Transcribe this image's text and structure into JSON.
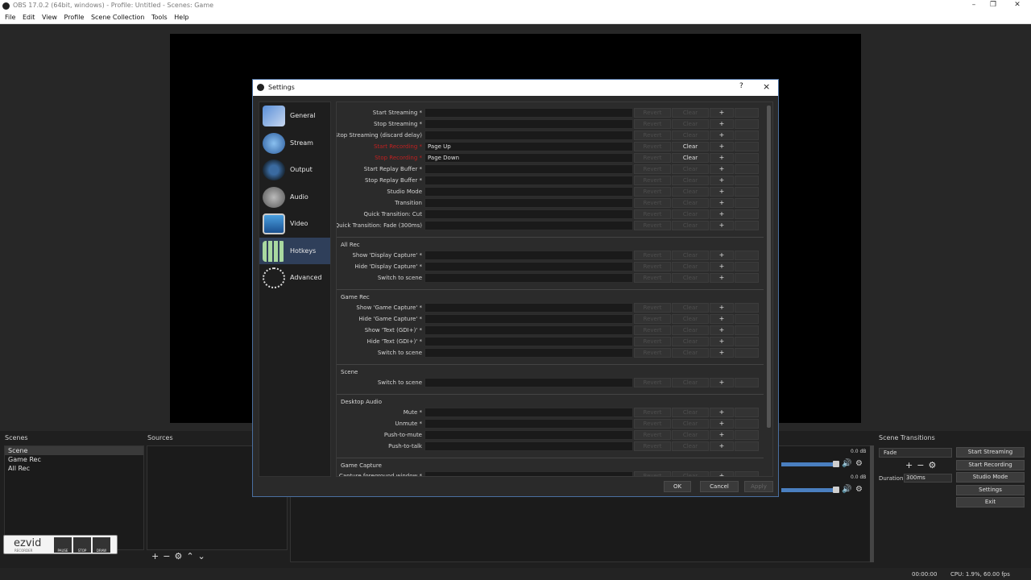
{
  "app": {
    "title": "OBS 17.0.2 (64bit, windows) - Profile: Untitled - Scenes: Game",
    "menu": [
      "File",
      "Edit",
      "View",
      "Profile",
      "Scene Collection",
      "Tools",
      "Help"
    ]
  },
  "docks": {
    "scenes_header": "Scenes",
    "sources_header": "Sources",
    "transitions_header": "Scene Transitions",
    "scenes": [
      "Scene",
      "Game Rec",
      "All Rec"
    ],
    "selected_scene": "Scene",
    "transition": "Fade",
    "duration_label": "Duration",
    "duration_value": "300ms",
    "mixer_db": [
      "0.0 dB",
      "0.0 dB"
    ],
    "mixer_levels": [
      0.97,
      0.97
    ]
  },
  "controls": {
    "start_streaming": "Start Streaming",
    "start_recording": "Start Recording",
    "studio_mode": "Studio Mode",
    "settings": "Settings",
    "exit": "Exit"
  },
  "status": {
    "time": "00:00:00",
    "cpu": "CPU: 1.9%, 60.00 fps"
  },
  "settings": {
    "title": "Settings",
    "help_icon": "?",
    "close_icon": "×",
    "nav": [
      {
        "label": "General",
        "icon": "general-icon"
      },
      {
        "label": "Stream",
        "icon": "stream-icon"
      },
      {
        "label": "Output",
        "icon": "output-icon"
      },
      {
        "label": "Audio",
        "icon": "audio-icon"
      },
      {
        "label": "Video",
        "icon": "video-icon"
      },
      {
        "label": "Hotkeys",
        "icon": "hotkeys-icon"
      },
      {
        "label": "Advanced",
        "icon": "advanced-icon"
      }
    ],
    "selected_nav": "Hotkeys",
    "button_labels": {
      "revert": "Revert",
      "clear": "Clear",
      "add": "+"
    },
    "groups": [
      {
        "title": "",
        "rows": [
          {
            "label": "Start Streaming *",
            "value": ""
          },
          {
            "label": "Stop Streaming *",
            "value": ""
          },
          {
            "label": "Stop Streaming (discard delay)",
            "value": ""
          },
          {
            "label": "Start Recording *",
            "value": "Page Up",
            "highlight": true
          },
          {
            "label": "Stop Recording *",
            "value": "Page Down",
            "highlight": true
          },
          {
            "label": "Start Replay Buffer *",
            "value": ""
          },
          {
            "label": "Stop Replay Buffer *",
            "value": ""
          },
          {
            "label": "Studio Mode",
            "value": ""
          },
          {
            "label": "Transition",
            "value": ""
          },
          {
            "label": "Quick Transition: Cut",
            "value": ""
          },
          {
            "label": "Quick Transition: Fade (300ms)",
            "value": ""
          }
        ]
      },
      {
        "title": "All Rec",
        "rows": [
          {
            "label": "Show 'Display Capture' *",
            "value": ""
          },
          {
            "label": "Hide 'Display Capture' *",
            "value": ""
          },
          {
            "label": "Switch to scene",
            "value": ""
          }
        ]
      },
      {
        "title": "Game Rec",
        "rows": [
          {
            "label": "Show 'Game Capture' *",
            "value": ""
          },
          {
            "label": "Hide 'Game Capture' *",
            "value": ""
          },
          {
            "label": "Show 'Text (GDI+)' *",
            "value": ""
          },
          {
            "label": "Hide 'Text (GDI+)' *",
            "value": ""
          },
          {
            "label": "Switch to scene",
            "value": ""
          }
        ]
      },
      {
        "title": "Scene",
        "rows": [
          {
            "label": "Switch to scene",
            "value": ""
          }
        ]
      },
      {
        "title": "Desktop Audio",
        "rows": [
          {
            "label": "Mute *",
            "value": ""
          },
          {
            "label": "Unmute *",
            "value": ""
          },
          {
            "label": "Push-to-mute",
            "value": ""
          },
          {
            "label": "Push-to-talk",
            "value": ""
          }
        ]
      },
      {
        "title": "Game Capture",
        "rows": [
          {
            "label": "Capture foreground window *",
            "value": ""
          },
          {
            "label": "Deactivate capture *",
            "value": ""
          }
        ]
      }
    ],
    "ok": "OK",
    "cancel": "Cancel",
    "apply": "Apply"
  },
  "overlay": {
    "logo": "ezvid",
    "logo_sub": "RECORDER",
    "buttons": [
      "PAUSE",
      "STOP",
      "DRAW"
    ]
  },
  "colors": {
    "accent": "#4a6fa0",
    "highlight_label": "#c02020",
    "nav_selected": "#2f3f5a"
  }
}
